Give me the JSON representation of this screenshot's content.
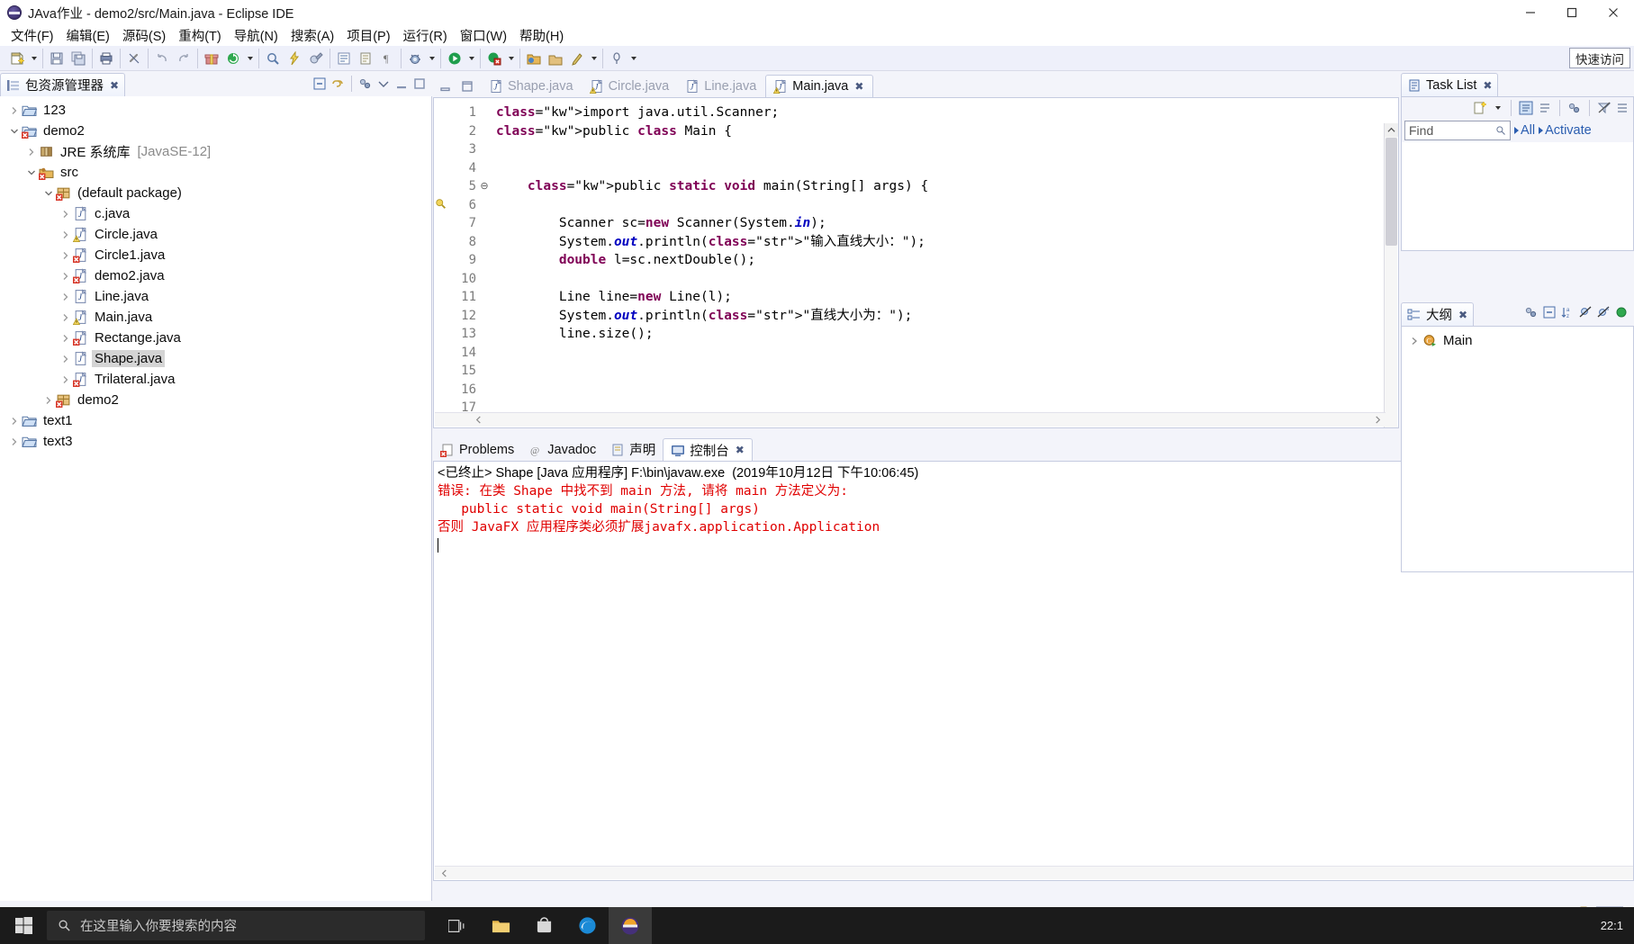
{
  "window": {
    "title": "JAva作业 - demo2/src/Main.java - Eclipse IDE",
    "app_icon": "eclipse-icon",
    "minimize_label": "—",
    "maximize_label": "□",
    "close_label": "✕"
  },
  "menubar": {
    "items": [
      {
        "label": "文件(F)",
        "name": "menu-file"
      },
      {
        "label": "编辑(E)",
        "name": "menu-edit"
      },
      {
        "label": "源码(S)",
        "name": "menu-source"
      },
      {
        "label": "重构(T)",
        "name": "menu-refactor"
      },
      {
        "label": "导航(N)",
        "name": "menu-navigate"
      },
      {
        "label": "搜索(A)",
        "name": "menu-search"
      },
      {
        "label": "项目(P)",
        "name": "menu-project"
      },
      {
        "label": "运行(R)",
        "name": "menu-run"
      },
      {
        "label": "窗口(W)",
        "name": "menu-window"
      },
      {
        "label": "帮助(H)",
        "name": "menu-help"
      }
    ]
  },
  "toolbar": {
    "quick_access": "快速访问",
    "buttons": [
      "new-wizard-icon",
      "save-icon",
      "save-all-icon",
      "print-icon",
      "link-break-icon",
      "undo-icon",
      "redo-icon",
      "gift-icon",
      "refresh-icon",
      "search-icon",
      "run-last-icon",
      "external-tools-icon",
      "open-type-icon",
      "open-task-icon",
      "pilcrow-icon",
      "debug-icon",
      "run-icon",
      "coverage-icon",
      "new-java-project-icon",
      "new-package-icon",
      "new-class-icon",
      "perspective-icon"
    ]
  },
  "package_explorer": {
    "title": "包资源管理器",
    "title_icon": "package-explorer-icon",
    "close_icon": "close-icon",
    "tools": [
      "collapse-all-icon",
      "link-with-editor-icon",
      "view-menu-icon",
      "minimize-icon",
      "maximize-icon"
    ],
    "tree": [
      {
        "label": "123",
        "indent": 0,
        "twisty": "collapsed",
        "icon": "project-closed-icon",
        "selected": false,
        "sub": ""
      },
      {
        "label": "demo2",
        "indent": 0,
        "twisty": "expanded",
        "icon": "project-error-icon",
        "selected": false,
        "sub": ""
      },
      {
        "label": "JRE 系统库",
        "indent": 1,
        "twisty": "collapsed",
        "icon": "jre-library-icon",
        "selected": false,
        "sub": "[JavaSE-12]"
      },
      {
        "label": "src",
        "indent": 1,
        "twisty": "expanded",
        "icon": "source-folder-error-icon",
        "selected": false,
        "sub": ""
      },
      {
        "label": "(default package)",
        "indent": 2,
        "twisty": "expanded",
        "icon": "package-error-icon",
        "selected": false,
        "sub": ""
      },
      {
        "label": "c.java",
        "indent": 3,
        "twisty": "collapsed",
        "icon": "java-file-icon",
        "selected": false,
        "sub": ""
      },
      {
        "label": "Circle.java",
        "indent": 3,
        "twisty": "collapsed",
        "icon": "java-file-warning-icon",
        "selected": false,
        "sub": ""
      },
      {
        "label": "Circle1.java",
        "indent": 3,
        "twisty": "collapsed",
        "icon": "java-file-error-icon",
        "selected": false,
        "sub": ""
      },
      {
        "label": "demo2.java",
        "indent": 3,
        "twisty": "collapsed",
        "icon": "java-file-error-icon",
        "selected": false,
        "sub": ""
      },
      {
        "label": "Line.java",
        "indent": 3,
        "twisty": "collapsed",
        "icon": "java-file-icon",
        "selected": false,
        "sub": ""
      },
      {
        "label": "Main.java",
        "indent": 3,
        "twisty": "collapsed",
        "icon": "java-file-warning-icon",
        "selected": false,
        "sub": ""
      },
      {
        "label": "Rectange.java",
        "indent": 3,
        "twisty": "collapsed",
        "icon": "java-file-error-icon",
        "selected": false,
        "sub": ""
      },
      {
        "label": "Shape.java",
        "indent": 3,
        "twisty": "collapsed",
        "icon": "java-file-icon",
        "selected": true,
        "sub": ""
      },
      {
        "label": "Trilateral.java",
        "indent": 3,
        "twisty": "collapsed",
        "icon": "java-file-error-icon",
        "selected": false,
        "sub": ""
      },
      {
        "label": "demo2",
        "indent": 2,
        "twisty": "collapsed",
        "icon": "package-error-icon",
        "selected": false,
        "sub": ""
      },
      {
        "label": "text1",
        "indent": 0,
        "twisty": "collapsed",
        "icon": "project-closed-icon",
        "selected": false,
        "sub": ""
      },
      {
        "label": "text3",
        "indent": 0,
        "twisty": "collapsed",
        "icon": "project-closed-icon",
        "selected": false,
        "sub": ""
      }
    ]
  },
  "editor": {
    "minimize_label": "minimize-icon",
    "maximize_label": "maximize-icon",
    "tabs": [
      {
        "label": "Shape.java",
        "icon": "java-file-icon",
        "active": false
      },
      {
        "label": "Circle.java",
        "icon": "java-file-warning-icon",
        "active": false
      },
      {
        "label": "Line.java",
        "icon": "java-file-icon",
        "active": false
      },
      {
        "label": "Main.java",
        "icon": "java-file-warning-icon",
        "active": true
      }
    ],
    "active_tab_close": "✕",
    "line_numbers": [
      "1",
      "2",
      "3",
      "4",
      "5",
      "6",
      "7",
      "8",
      "9",
      "10",
      "11",
      "12",
      "13",
      "14",
      "15",
      "16",
      "17"
    ],
    "lines": [
      "import java.util.Scanner;",
      "public class Main {",
      "",
      "",
      "    public static void main(String[] args) {",
      "",
      "        Scanner sc=new Scanner(System.in);",
      "        System.out.println(\"输入直线大小：\");",
      "        double l=sc.nextDouble();",
      "",
      "        Line line=new Line(l);",
      "        System.out.println(\"直线大小为：\");",
      "        line.size();",
      "",
      "",
      "",
      ""
    ],
    "fold_markers": {
      "5": "⊖"
    },
    "warning_marker_line": "7"
  },
  "console": {
    "tabs": [
      {
        "label": "Problems",
        "icon": "problems-icon",
        "active": false
      },
      {
        "label": "Javadoc",
        "icon": "javadoc-icon",
        "active": false
      },
      {
        "label": "声明",
        "icon": "declaration-icon",
        "active": false
      },
      {
        "label": "控制台",
        "icon": "console-icon",
        "active": true
      }
    ],
    "active_close": "✕",
    "tools": [
      "terminate-icon",
      "remove-launch-icon",
      "remove-all-icon",
      "clear-icon",
      "scroll-lock-icon",
      "word-wrap-icon",
      "pin-icon",
      "display-selected-icon",
      "open-console-icon",
      "view-menu-icon",
      "minimize-icon",
      "maximize-icon"
    ],
    "output": [
      {
        "text": "<已终止> Shape [Java 应用程序] F:\\bin\\javaw.exe  (2019年10月12日 下午10:06:45)",
        "kind": "header"
      },
      {
        "text": "错误: 在类 Shape 中找不到 main 方法, 请将 main 方法定义为:",
        "kind": "error"
      },
      {
        "text": "   public static void main(String[] args)",
        "kind": "error"
      },
      {
        "text": "否则 JavaFX 应用程序类必须扩展javafx.application.Application",
        "kind": "error"
      }
    ]
  },
  "task_list": {
    "title": "Task List",
    "title_icon": "task-list-icon",
    "close_icon": "close-icon",
    "tools": [
      "new-task-icon",
      "dropdown-arrow-icon",
      "categorized-icon",
      "scheduled-icon",
      "focus-icon",
      "filter-off-icon",
      "view-menu-icon"
    ],
    "find_placeholder": "Find",
    "find_value": "",
    "search_icon": "search-icon",
    "filters": [
      {
        "label": "All",
        "name": "task-filter-all"
      },
      {
        "label": "Activate",
        "name": "task-filter-activate"
      }
    ]
  },
  "outline": {
    "title": "大纲",
    "title_icon": "outline-icon",
    "close_icon": "close-icon",
    "tools": [
      "focus-icon",
      "collapse-all-icon",
      "sort-icon",
      "hide-fields-icon",
      "hide-static-icon",
      "hide-nonpublic-icon"
    ],
    "tree": [
      {
        "label": "Main",
        "icon": "class-icon",
        "twisty": "collapsed"
      }
    ]
  },
  "taskbar": {
    "start_icon": "windows-start-icon",
    "search_placeholder": "在这里输入你要搜索的内容",
    "search_icon": "search-icon",
    "apps": [
      {
        "name": "taskview-icon",
        "active": false
      },
      {
        "name": "explorer-icon",
        "active": false
      },
      {
        "name": "store-icon",
        "active": false
      },
      {
        "name": "edge-icon",
        "active": false
      },
      {
        "name": "eclipse-icon",
        "active": true
      }
    ],
    "clock_time": "22:1",
    "clock_date": ""
  },
  "colors": {
    "accent": "#2a5db0",
    "error": "#e00000",
    "keyword": "#7f0055",
    "string": "#2a00ff",
    "field": "#0000c0",
    "chrome": "#eef0fa",
    "selection": "#d4d4d4"
  }
}
